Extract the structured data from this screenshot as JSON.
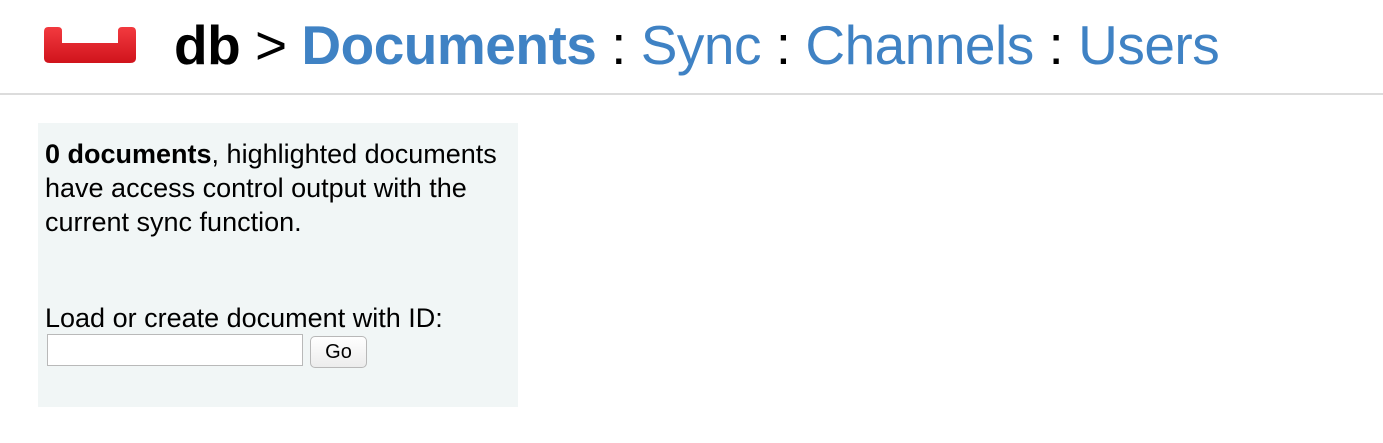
{
  "header": {
    "db_name": "db",
    "breadcrumb_separator": ">",
    "nav_separator": ":",
    "nav": {
      "documents": "Documents",
      "sync": "Sync",
      "channels": "Channels",
      "users": "Users"
    },
    "active_nav": "Documents"
  },
  "sidebar": {
    "document_count": "0 documents",
    "summary_rest": ", highlighted documents have access control output with the current sync function.",
    "load_label": "Load or create document with ID:",
    "doc_id_value": "",
    "go_label": "Go"
  },
  "colors": {
    "link": "#3f82c4",
    "logo_red": "#e8202a",
    "sidebar_bg": "#f1f6f6"
  },
  "icons": {
    "logo": "couchbase-logo-icon"
  }
}
